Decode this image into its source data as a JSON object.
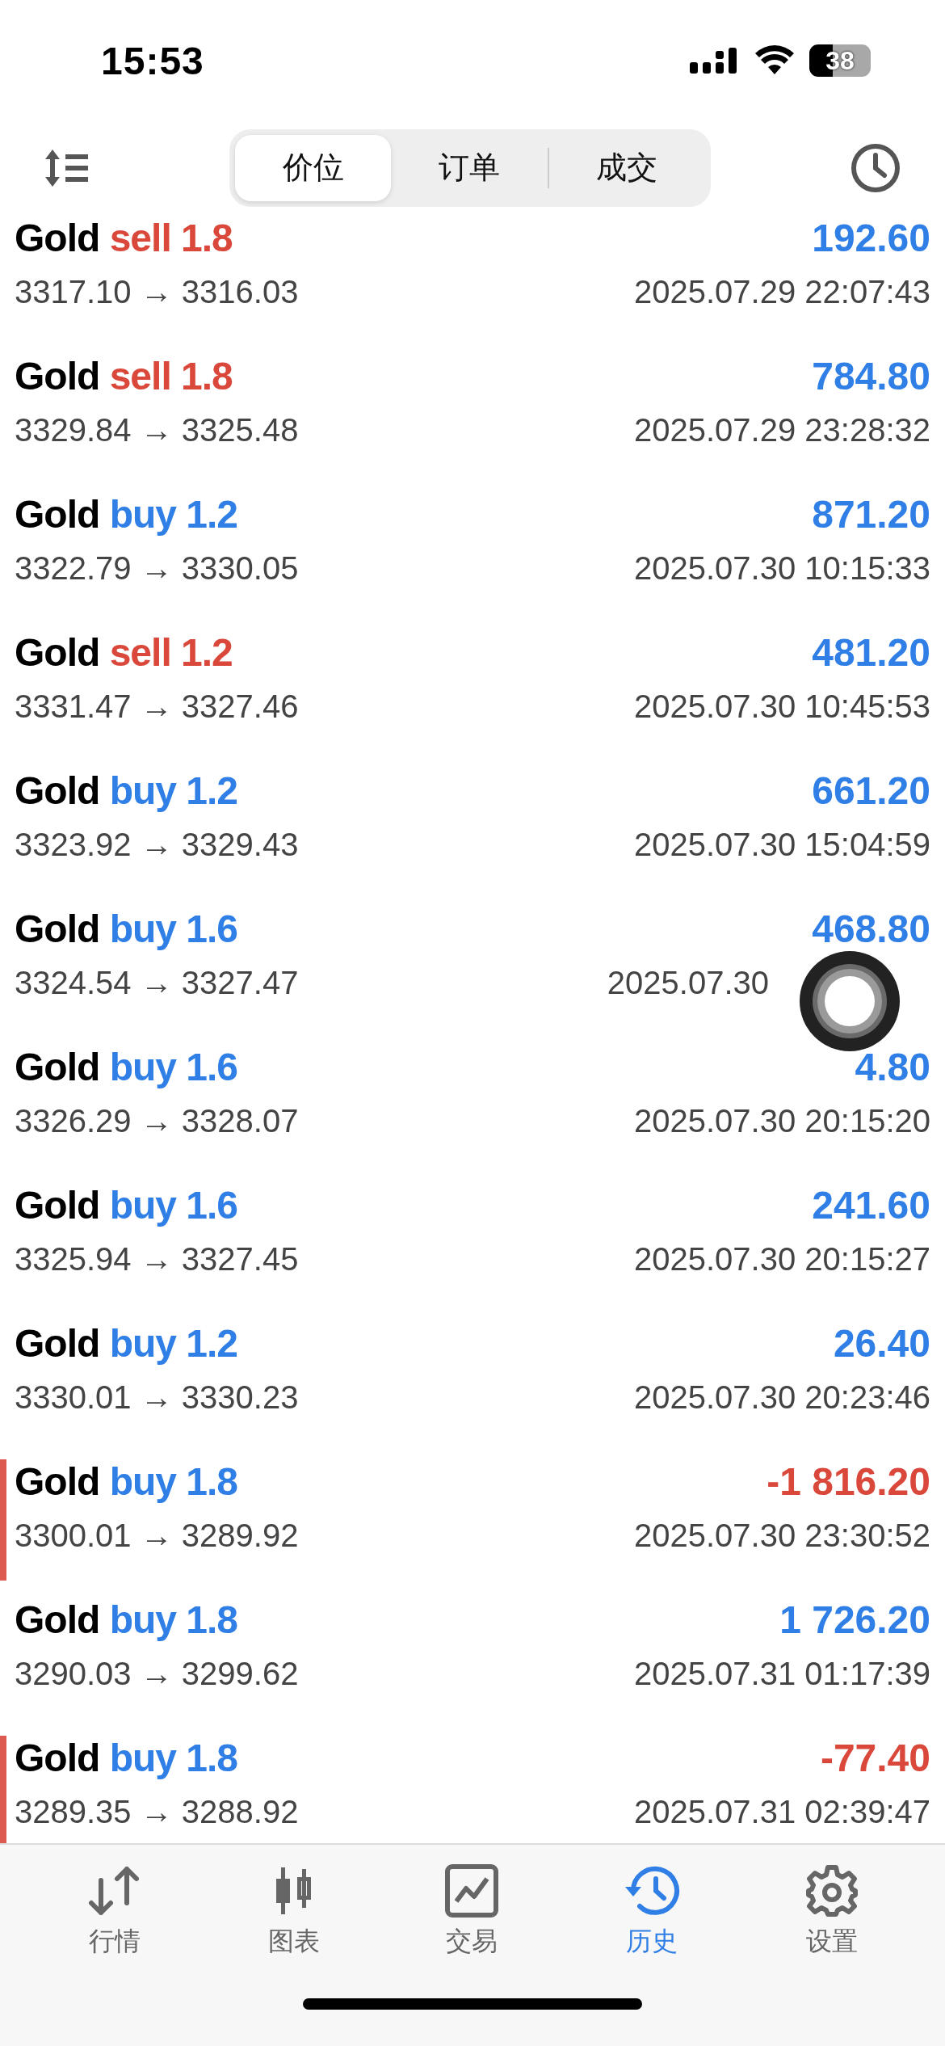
{
  "status_bar": {
    "time": "15:53",
    "battery": "38"
  },
  "segments": [
    {
      "label": "价位",
      "selected": true
    },
    {
      "label": "订单",
      "selected": false
    },
    {
      "label": "成交",
      "selected": false
    }
  ],
  "deals": [
    {
      "symbol": "Gold",
      "side": "sell",
      "volume": "1.8",
      "sell": true,
      "prices": "3317.10 → 3316.03",
      "profit": "192.60",
      "loss": false,
      "time": "2025.07.29 22:07:43"
    },
    {
      "symbol": "Gold",
      "side": "sell",
      "volume": "1.8",
      "sell": true,
      "prices": "3329.84 → 3325.48",
      "profit": "784.80",
      "loss": false,
      "time": "2025.07.29 23:28:32"
    },
    {
      "symbol": "Gold",
      "side": "buy",
      "volume": "1.2",
      "sell": false,
      "prices": "3322.79 → 3330.05",
      "profit": "871.20",
      "loss": false,
      "time": "2025.07.30 10:15:33"
    },
    {
      "symbol": "Gold",
      "side": "sell",
      "volume": "1.2",
      "sell": true,
      "prices": "3331.47 → 3327.46",
      "profit": "481.20",
      "loss": false,
      "time": "2025.07.30 10:45:53"
    },
    {
      "symbol": "Gold",
      "side": "buy",
      "volume": "1.2",
      "sell": false,
      "prices": "3323.92 → 3329.43",
      "profit": "661.20",
      "loss": false,
      "time": "2025.07.30 15:04:59"
    },
    {
      "symbol": "Gold",
      "side": "buy",
      "volume": "1.6",
      "sell": false,
      "prices": "3324.54 → 3327.47",
      "profit": "468.80",
      "loss": false,
      "time": "2025.07.30"
    },
    {
      "symbol": "Gold",
      "side": "buy",
      "volume": "1.6",
      "sell": false,
      "prices": "3326.29 → 3328.07",
      "profit": "4.80",
      "loss": false,
      "time": "2025.07.30 20:15:20"
    },
    {
      "symbol": "Gold",
      "side": "buy",
      "volume": "1.6",
      "sell": false,
      "prices": "3325.94 → 3327.45",
      "profit": "241.60",
      "loss": false,
      "time": "2025.07.30 20:15:27"
    },
    {
      "symbol": "Gold",
      "side": "buy",
      "volume": "1.2",
      "sell": false,
      "prices": "3330.01 → 3330.23",
      "profit": "26.40",
      "loss": false,
      "time": "2025.07.30 20:23:46"
    },
    {
      "symbol": "Gold",
      "side": "buy",
      "volume": "1.8",
      "sell": false,
      "prices": "3300.01 → 3289.92",
      "profit": "-1 816.20",
      "loss": true,
      "time": "2025.07.30 23:30:52"
    },
    {
      "symbol": "Gold",
      "side": "buy",
      "volume": "1.8",
      "sell": false,
      "prices": "3290.03 → 3299.62",
      "profit": "1 726.20",
      "loss": false,
      "time": "2025.07.31 01:17:39"
    },
    {
      "symbol": "Gold",
      "side": "buy",
      "volume": "1.8",
      "sell": false,
      "prices": "3289.35 → 3288.92",
      "profit": "-77.40",
      "loss": true,
      "time": "2025.07.31 02:39:47"
    }
  ],
  "tab_bar": [
    {
      "label": "行情",
      "kind": "quotes",
      "selected": false
    },
    {
      "label": "图表",
      "kind": "chart",
      "selected": false
    },
    {
      "label": "交易",
      "kind": "trade",
      "selected": false
    },
    {
      "label": "历史",
      "kind": "history",
      "selected": true
    },
    {
      "label": "设置",
      "kind": "settings",
      "selected": false
    }
  ]
}
